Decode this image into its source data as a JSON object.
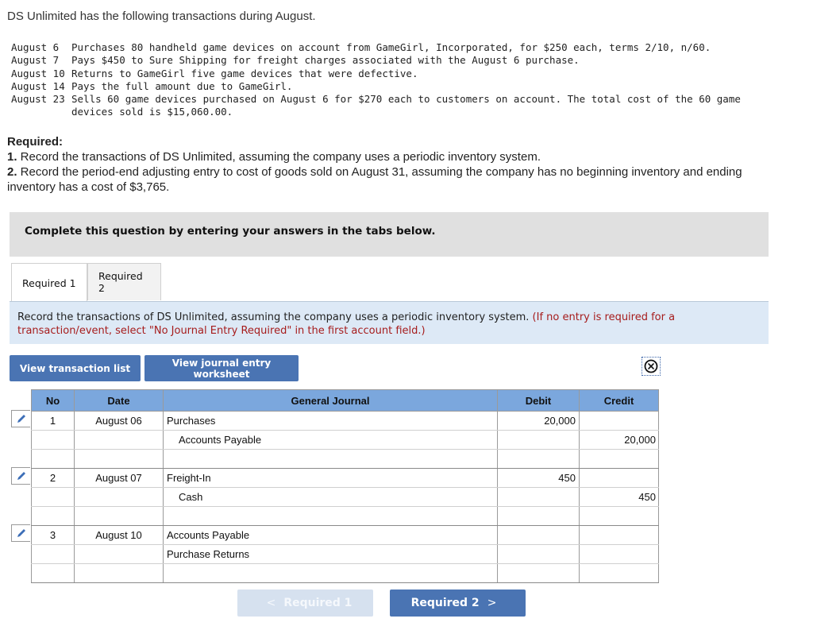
{
  "intro": "DS Unlimited has the following transactions during August.",
  "transactions": [
    {
      "date": "August 6",
      "desc": "Purchases 80 handheld game devices on account from GameGirl, Incorporated, for $250 each, terms 2/10, n/60."
    },
    {
      "date": "August 7",
      "desc": "Pays $450 to Sure Shipping for freight charges associated with the August 6 purchase."
    },
    {
      "date": "August 10",
      "desc": "Returns to GameGirl five game devices that were defective."
    },
    {
      "date": "August 14",
      "desc": "Pays the full amount due to GameGirl."
    },
    {
      "date": "August 23",
      "desc": "Sells 60 game devices purchased on August 6 for $270 each to customers on account. The total cost of the 60 game devices sold is $15,060.00."
    }
  ],
  "required": {
    "heading": "Required:",
    "items": [
      {
        "num": "1.",
        "text": " Record the transactions of DS Unlimited, assuming the company uses a periodic inventory system."
      },
      {
        "num": "2.",
        "text": " Record the period-end adjusting entry to cost of goods sold on August 31, assuming the company has no beginning inventory and ending inventory has a cost of $3,765."
      }
    ]
  },
  "banner": "Complete this question by entering your answers in the tabs below.",
  "tabs": [
    {
      "label": "Required 1",
      "active": true
    },
    {
      "label": "Required 2",
      "active": false
    }
  ],
  "instruction": {
    "text": "Record the transactions of DS Unlimited, assuming the company uses a periodic inventory system.",
    "note": "(If no entry is required for a transaction/event, select \"No Journal Entry Required\" in the first account field.)"
  },
  "buttons": {
    "view_transactions": "View transaction list",
    "view_worksheet": "View journal entry worksheet"
  },
  "icons": {
    "close": "circle-x-icon",
    "edit": "pencil-icon"
  },
  "journal": {
    "headers": {
      "no": "No",
      "date": "Date",
      "account": "General Journal",
      "debit": "Debit",
      "credit": "Credit"
    },
    "entries": [
      {
        "no": "1",
        "date": "August 06",
        "lines": [
          {
            "account": "Purchases",
            "debit": "20,000",
            "credit": ""
          },
          {
            "account": "Accounts Payable",
            "debit": "",
            "credit": "20,000"
          },
          {
            "account": "",
            "debit": "",
            "credit": ""
          }
        ]
      },
      {
        "no": "2",
        "date": "August 07",
        "lines": [
          {
            "account": "Freight-In",
            "debit": "450",
            "credit": ""
          },
          {
            "account": "Cash",
            "debit": "",
            "credit": "450"
          },
          {
            "account": "",
            "debit": "",
            "credit": ""
          }
        ]
      },
      {
        "no": "3",
        "date": "August 10",
        "lines": [
          {
            "account": "Accounts Payable",
            "debit": "",
            "credit": ""
          },
          {
            "account": "Purchase Returns",
            "debit": "",
            "credit": ""
          },
          {
            "account": "",
            "debit": "",
            "credit": ""
          }
        ]
      }
    ]
  },
  "nav": {
    "prev_label": "Required 1",
    "next_label": "Required 2",
    "prev_chevron": "<",
    "next_chevron": ">"
  },
  "colors": {
    "button_blue": "#4a74b3",
    "header_blue": "#7ba7dd",
    "note_red": "#a61c1c",
    "instruction_bg": "#dde9f6"
  }
}
